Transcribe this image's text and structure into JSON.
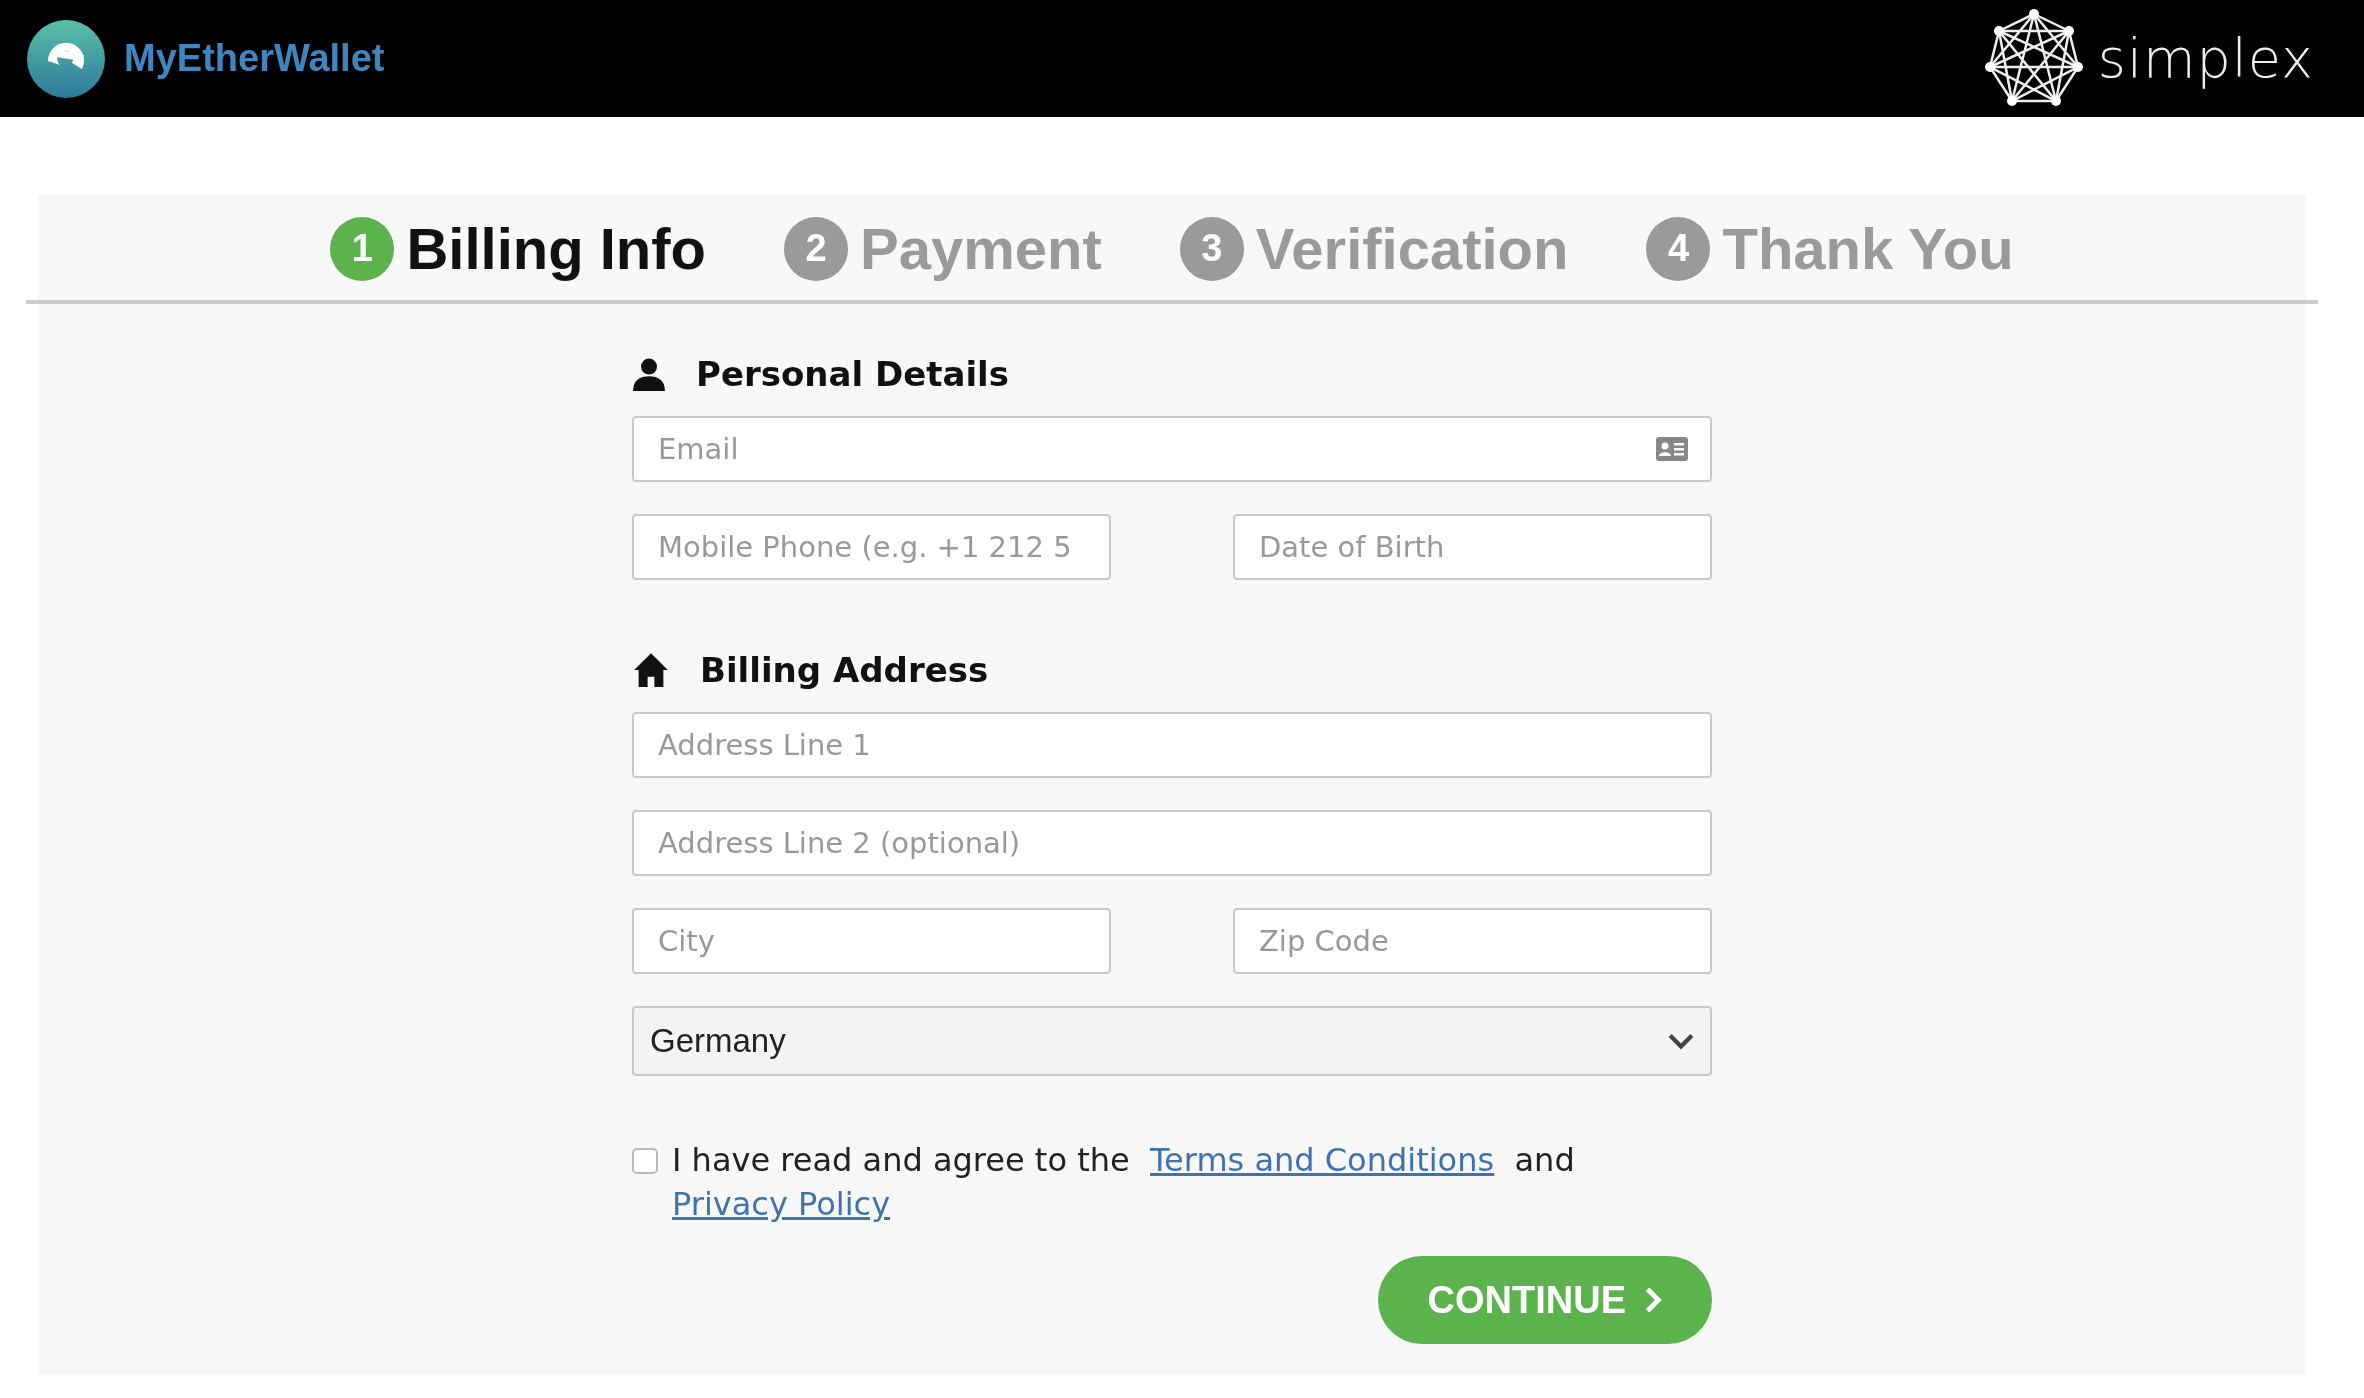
{
  "header": {
    "brand": "MyEtherWallet",
    "partner": "simplex"
  },
  "steps": [
    {
      "number": "1",
      "label": "Billing Info",
      "selected": true
    },
    {
      "number": "2",
      "label": "Payment",
      "selected": false
    },
    {
      "number": "3",
      "label": "Verification",
      "selected": false
    },
    {
      "number": "4",
      "label": "Thank You",
      "selected": false
    }
  ],
  "sections": [
    {
      "kind": "person",
      "title": "Personal Details",
      "rows": [
        [
          {
            "placeholder": "Email",
            "kind": "email"
          }
        ],
        [
          {
            "placeholder": "Mobile Phone (e.g. +1 212 5"
          },
          {
            "placeholder": "Date of Birth"
          }
        ]
      ]
    },
    {
      "kind": "home",
      "title": "Billing Address",
      "rows": [
        [
          {
            "placeholder": "Address Line 1"
          }
        ],
        [
          {
            "placeholder": "Address Line 2 (optional)"
          }
        ],
        [
          {
            "placeholder": "City"
          },
          {
            "placeholder": "Zip Code"
          }
        ]
      ]
    }
  ],
  "country": {
    "value": "Germany"
  },
  "agreement": {
    "checked": false,
    "text": "I have read and agree to the",
    "link_1": "Terms and Conditions",
    "joiner": "and",
    "link_2": "Privacy Policy"
  },
  "continue_button": {
    "label": "CONTINUE"
  }
}
